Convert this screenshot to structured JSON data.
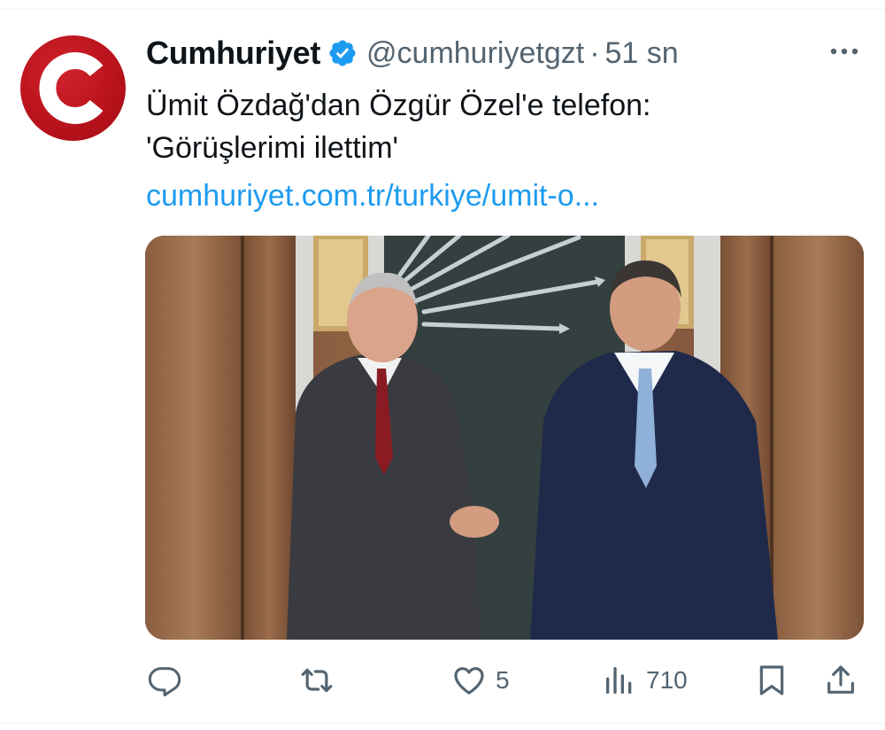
{
  "tweet": {
    "author_name": "Cumhuriyet",
    "handle": "@cumhuriyetgzt",
    "separator": "·",
    "time": "51 sn",
    "text_line1": "Ümit Özdağ'dan Özgür Özel'e telefon:",
    "text_line2": "'Görüşlerimi ilettim'",
    "link": "cumhuriyet.com.tr/turkiye/umit-o..."
  },
  "actions": {
    "replies": "",
    "retweets": "",
    "likes": "5",
    "views": "710"
  },
  "colors": {
    "accent": "#1d9bf0",
    "secondary_text": "#536471",
    "brand_red": "#c4141e"
  },
  "icons": [
    "cumhuriyet-logo",
    "verified-badge-icon",
    "more-icon",
    "reply-icon",
    "retweet-icon",
    "like-icon",
    "views-icon",
    "bookmark-icon",
    "share-icon"
  ]
}
